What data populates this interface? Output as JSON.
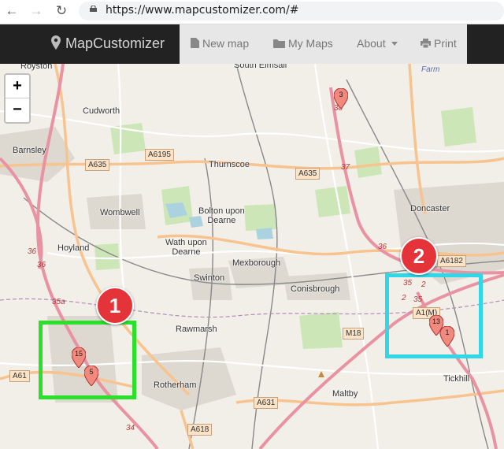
{
  "browser": {
    "url": "https://www.mapcustomizer.com/#"
  },
  "navbar": {
    "brand": "MapCustomizer",
    "items": [
      {
        "label": "New map",
        "icon": "file-icon"
      },
      {
        "label": "My Maps",
        "icon": "folder-icon"
      },
      {
        "label": "About",
        "icon": "caret-down-icon"
      },
      {
        "label": "Print",
        "icon": "print-icon"
      }
    ]
  },
  "map": {
    "zoom_in": "+",
    "zoom_out": "−",
    "places": [
      "Royston",
      "South Elmsall",
      "Farm",
      "Cudworth",
      "Barnsley",
      "Thurnscoe",
      "Wombwell",
      "Bolton upon\nDearne",
      "Doncaster",
      "Hoyland",
      "Wath upon\nDearne",
      "Mexborough",
      "Swinton",
      "Conisbrough",
      "Rawmarsh",
      "Rotherham",
      "Maltby",
      "Tickhill"
    ],
    "roads": [
      "A635",
      "A6195",
      "A635",
      "A6182",
      "A1(M)",
      "M18",
      "A61",
      "A631",
      "A618"
    ],
    "junctions": [
      "38",
      "37",
      "36",
      "36",
      "35",
      "2",
      "2",
      "35",
      "36",
      "35a",
      "34"
    ],
    "markers": [
      "3",
      "15",
      "5",
      "13",
      "1"
    ],
    "annotations": [
      "1",
      "2"
    ]
  },
  "colors": {
    "navbar_bg": "#222222",
    "navmenu_bg": "#e7e7e7",
    "marker_fill": "#f08a7e",
    "highlight_green": "#2be02b",
    "highlight_cyan": "#30d7e6",
    "badge_red": "#e5333a"
  }
}
